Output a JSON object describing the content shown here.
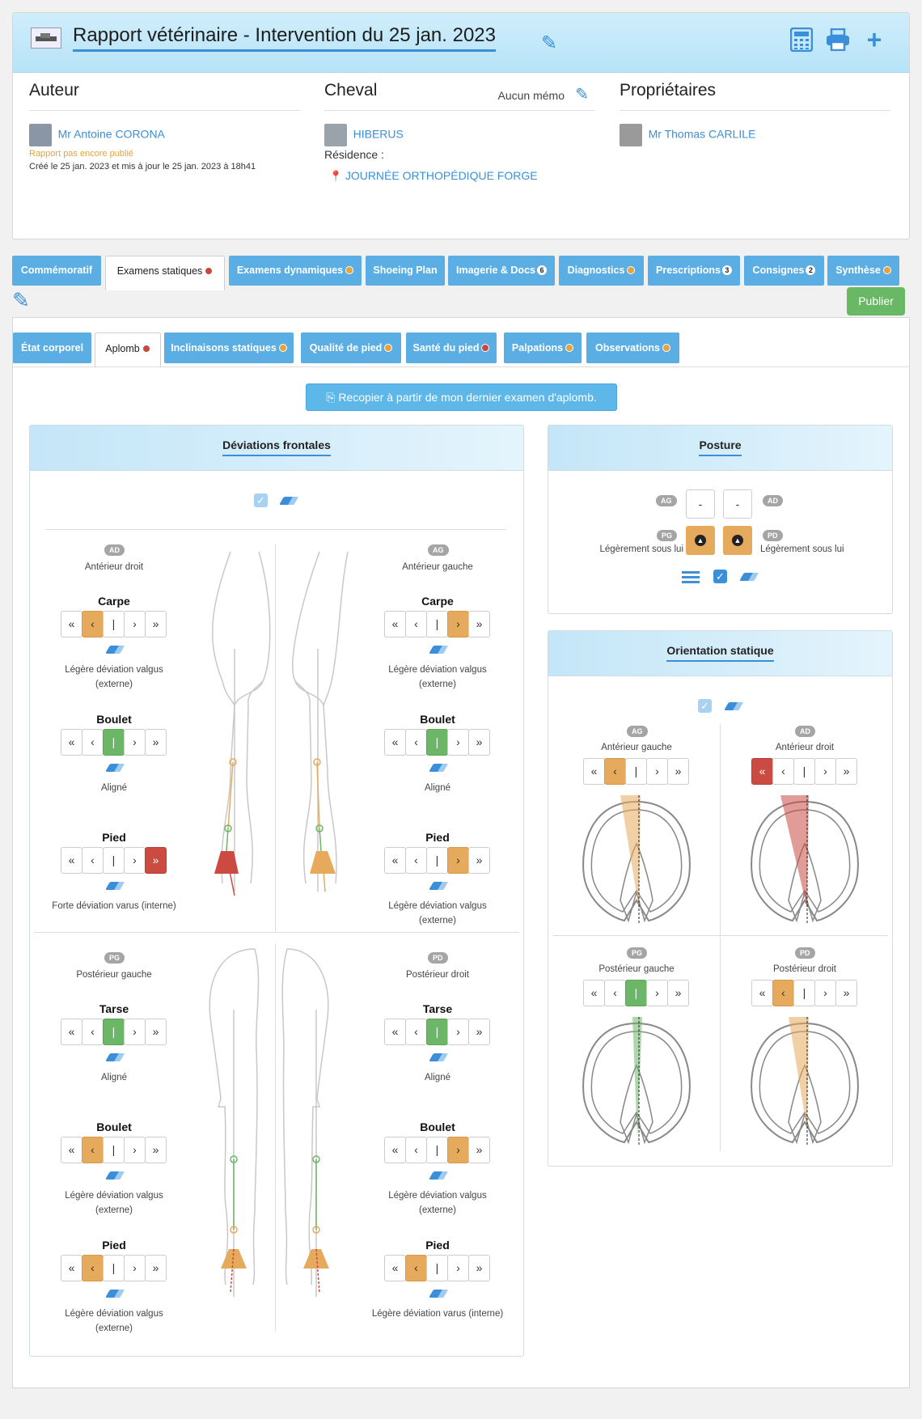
{
  "header": {
    "title": "Rapport vétérinaire - Intervention du 25 jan. 2023",
    "icons": [
      "pencil-icon",
      "calculator-icon",
      "printer-icon",
      "plus-icon"
    ]
  },
  "author": {
    "heading": "Auteur",
    "name": "Mr Antoine CORONA",
    "status": "Rapport pas encore publié",
    "dates": "Créé le 25 jan. 2023 et mis à jour le 25 jan. 2023 à 18h41"
  },
  "horse": {
    "heading": "Cheval",
    "memo": "Aucun mémo",
    "name": "HIBERUS",
    "residence_label": "Résidence :",
    "residence": "JOURNÉE ORTHOPÉDIQUE FORGE"
  },
  "owners": {
    "heading": "Propriétaires",
    "name": "Mr Thomas CARLILE"
  },
  "tabs": [
    {
      "label": "Commémoratif"
    },
    {
      "label": "Examens statiques"
    },
    {
      "label": "Examens dynamiques"
    },
    {
      "label": "Shoeing Plan"
    },
    {
      "label": "Imagerie & Docs",
      "badge": "6"
    },
    {
      "label": "Diagnostics"
    },
    {
      "label": "Prescriptions",
      "badge": "3"
    },
    {
      "label": "Consignes",
      "badge": "2"
    },
    {
      "label": "Synthèse"
    }
  ],
  "publish_label": "Publier",
  "subtabs": [
    {
      "label": "État corporel"
    },
    {
      "label": "Aplomb"
    },
    {
      "label": "Inclinaisons statiques"
    },
    {
      "label": "Qualité de pied"
    },
    {
      "label": "Santé du pied"
    },
    {
      "label": "Palpations"
    },
    {
      "label": "Observations"
    }
  ],
  "copy_button": "Recopier à partir de mon dernier examen d'aplomb.",
  "frontal": {
    "title": "Déviations frontales",
    "limbs": [
      {
        "code": "AD",
        "name": "Antérieur droit",
        "joints": [
          {
            "label": "Carpe",
            "selected": 1,
            "result": "Légère déviation valgus (externe)"
          },
          {
            "label": "Boulet",
            "selected": 2,
            "result": "Aligné"
          },
          {
            "label": "Pied",
            "selected": 4,
            "result": "Forte déviation varus (interne)"
          }
        ]
      },
      {
        "code": "AG",
        "name": "Antérieur gauche",
        "joints": [
          {
            "label": "Carpe",
            "selected": 3,
            "result": "Légère déviation valgus (externe)"
          },
          {
            "label": "Boulet",
            "selected": 2,
            "result": "Aligné"
          },
          {
            "label": "Pied",
            "selected": 3,
            "result": "Légère déviation valgus (externe)"
          }
        ]
      },
      {
        "code": "PG",
        "name": "Postérieur gauche",
        "joints": [
          {
            "label": "Tarse",
            "selected": 2,
            "result": "Aligné"
          },
          {
            "label": "Boulet",
            "selected": 1,
            "result": "Légère déviation valgus (externe)"
          },
          {
            "label": "Pied",
            "selected": 1,
            "result": "Légère déviation valgus (externe)"
          }
        ]
      },
      {
        "code": "PD",
        "name": "Postérieur droit",
        "joints": [
          {
            "label": "Tarse",
            "selected": 2,
            "result": "Aligné"
          },
          {
            "label": "Boulet",
            "selected": 3,
            "result": "Légère déviation valgus (externe)"
          },
          {
            "label": "Pied",
            "selected": 1,
            "result": "Légère déviation varus (interne)"
          }
        ]
      }
    ]
  },
  "posture": {
    "title": "Posture",
    "ag": "AG",
    "ad": "AD",
    "pg": "PG",
    "pd": "PD",
    "ag_value": "-",
    "ad_value": "-",
    "pg_text": "Légèrement sous lui",
    "pd_text": "Légèrement sous lui"
  },
  "orientation": {
    "title": "Orientation statique",
    "limbs": [
      {
        "code": "AG",
        "name": "Antérieur gauche",
        "selected": 1
      },
      {
        "code": "AD",
        "name": "Antérieur droit",
        "selected": 0
      },
      {
        "code": "PG",
        "name": "Postérieur gauche",
        "selected": 2
      },
      {
        "code": "PD",
        "name": "Postérieur droit",
        "selected": 1
      }
    ]
  },
  "button_glyphs": [
    "«",
    "‹",
    "|",
    "›",
    "»"
  ],
  "colors": {
    "accent": "#3b8fd8",
    "orange": "#e6aa5c",
    "green": "#6cb767",
    "red": "#cb4b42",
    "publish": "#69b866"
  }
}
